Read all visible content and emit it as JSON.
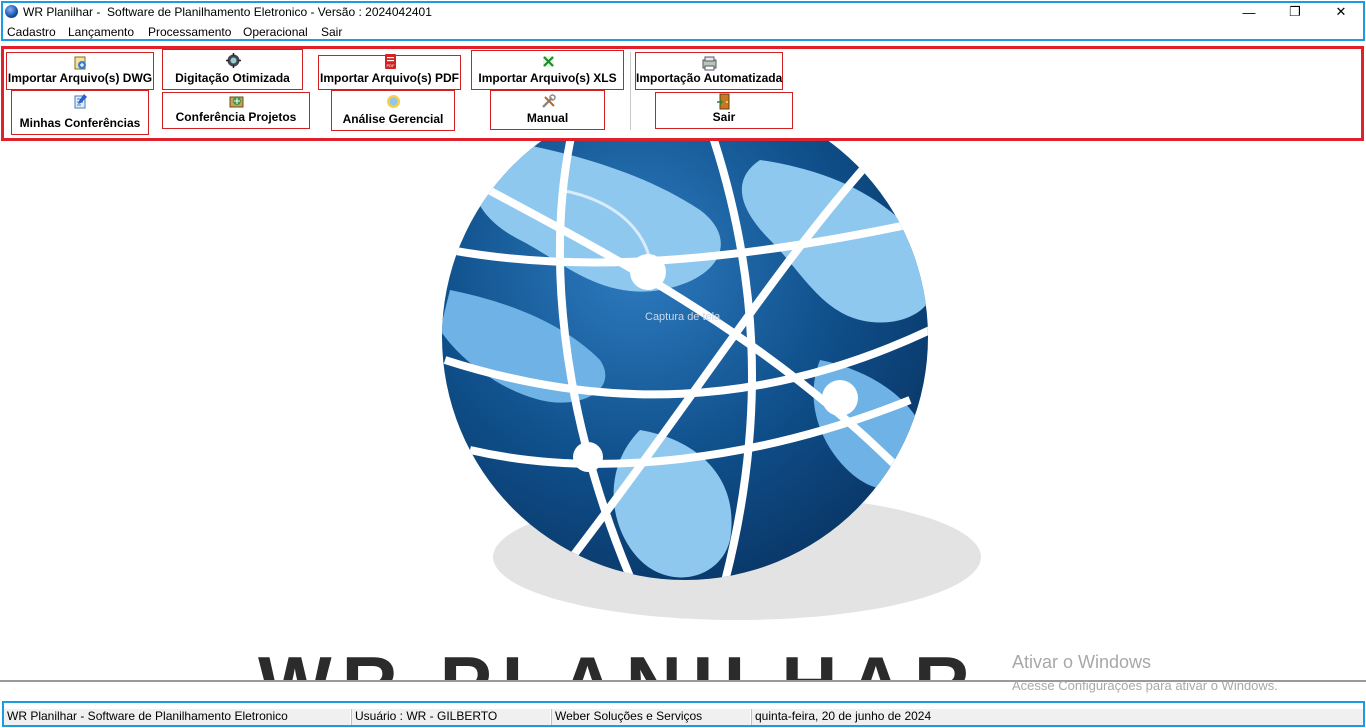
{
  "window": {
    "title": "WR Planilhar -  Software de Planilhamento Eletronico - Versão : 2024042401",
    "minimize": "—",
    "maximize": "❐",
    "close": "✕"
  },
  "menu": [
    "Cadastro",
    "Lançamento",
    "Processamento",
    "Operacional",
    "Sair"
  ],
  "toolbar": {
    "row1": [
      {
        "label": "Importar Arquivo(s) DWG",
        "icon": "dwg-import-icon"
      },
      {
        "label": "Digitação Otimizada",
        "icon": "gear-globe-icon"
      },
      {
        "label": "Importar Arquivo(s) PDF",
        "icon": "pdf-icon"
      },
      {
        "label": "Importar Arquivo(s) XLS",
        "icon": "excel-icon"
      },
      {
        "label": "Importação Automatizada",
        "icon": "auto-import-icon"
      }
    ],
    "row2": [
      {
        "label": "Minhas Conferências",
        "icon": "notepad-icon"
      },
      {
        "label": "Conferência Projetos",
        "icon": "projects-icon"
      },
      {
        "label": "Análise Gerencial",
        "icon": "analysis-icon"
      },
      {
        "label": "Manual",
        "icon": "tools-icon"
      },
      {
        "label": "Sair",
        "icon": "exit-door-icon"
      }
    ]
  },
  "main": {
    "brand_text": "WR PLANILHAR",
    "ghost_text": "Captura de tela"
  },
  "watermark": {
    "line1": "Ativar o Windows",
    "line2": "Acesse Configurações para ativar o Windows."
  },
  "status": {
    "app": "WR Planilhar -  Software de Planilhamento Eletronico",
    "user": "Usuário : WR - GILBERTO",
    "company": "Weber Soluções e Serviços",
    "date": "quinta-feira, 20 de junho de 2024"
  },
  "colors": {
    "toolbar_border": "#e0202a",
    "frame_border": "#1b9be0",
    "globe_dark": "#0f4f8a",
    "globe_light": "#8ec8ef"
  }
}
